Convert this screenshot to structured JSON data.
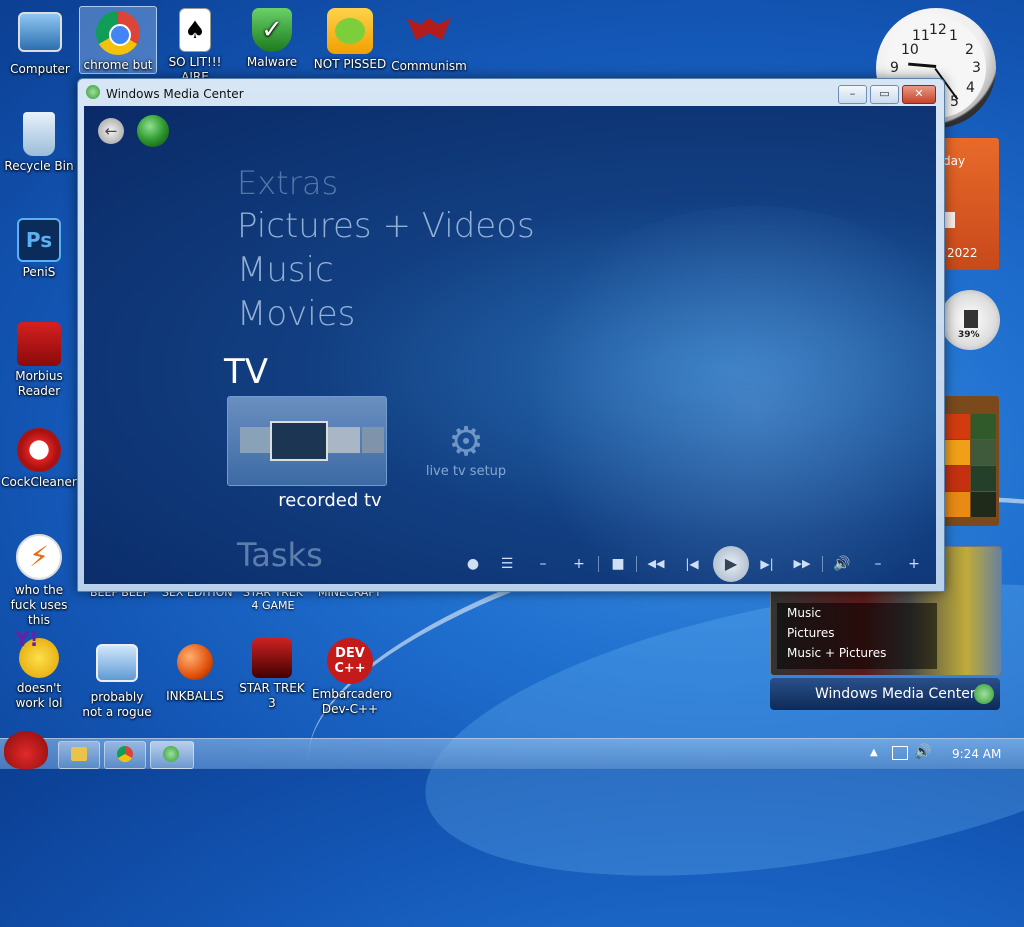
{
  "desktop": {
    "icons_top": [
      {
        "label": "Computer"
      },
      {
        "label": "chrome but"
      },
      {
        "label": "SO LIT!!! AIRE"
      },
      {
        "label": "Malware"
      },
      {
        "label": "NOT PISSED"
      },
      {
        "label": "Communism"
      }
    ],
    "icons_left": [
      {
        "label": "Recycle Bin"
      },
      {
        "label": "PeniS"
      },
      {
        "label": "Morbius Reader"
      },
      {
        "label": "CockCleaner"
      },
      {
        "label": "who the fuck uses this"
      }
    ],
    "partial_labels": [
      "BEEF BEEF",
      "SEX EDITION",
      "STAR TREK 4 GAME",
      "MINECRAFT"
    ],
    "icons_bottom": [
      {
        "label": "doesn't work lol"
      },
      {
        "label": "probably not a rogue"
      },
      {
        "label": "INKBALLS"
      },
      {
        "label": "STAR TREK 3"
      },
      {
        "label": "Embarcadero Dev-C++"
      }
    ],
    "ps_icon_text": "Ps",
    "dev_icon_text": "DEV C++"
  },
  "gadgets": {
    "calendar_day_partial": "day",
    "calendar_year": "2022",
    "cpu_percent": "39%",
    "wmc_list": [
      "Music",
      "Pictures",
      "Music + Pictures"
    ],
    "wmc_brand": "Windows Media Center"
  },
  "window": {
    "title": "Windows Media Center",
    "minimize_label": "–",
    "maximize_label": "▭",
    "close_label": "✕",
    "menu": [
      "Extras",
      "Pictures + Videos",
      "Music",
      "Movies"
    ],
    "current_section": "TV",
    "tile_label": "recorded tv",
    "setup_label": "live tv setup",
    "next_section": "Tasks"
  },
  "transport": {
    "record": "●",
    "guide": "☰",
    "ch_down": "–",
    "ch_up": "+",
    "stop": "■",
    "rewind": "◀◀",
    "prev": "|◀",
    "play": "▶",
    "next": "▶|",
    "ff": "▶▶",
    "mute": "🔊",
    "vol_down": "–",
    "vol_up": "+"
  },
  "taskbar": {
    "clock": "9:24 AM",
    "tray_arrow": "▲"
  },
  "colors": {
    "desktop_blue": "#1f6fcf",
    "wmc_blue": "#123f82",
    "close_red": "#c4442a"
  }
}
